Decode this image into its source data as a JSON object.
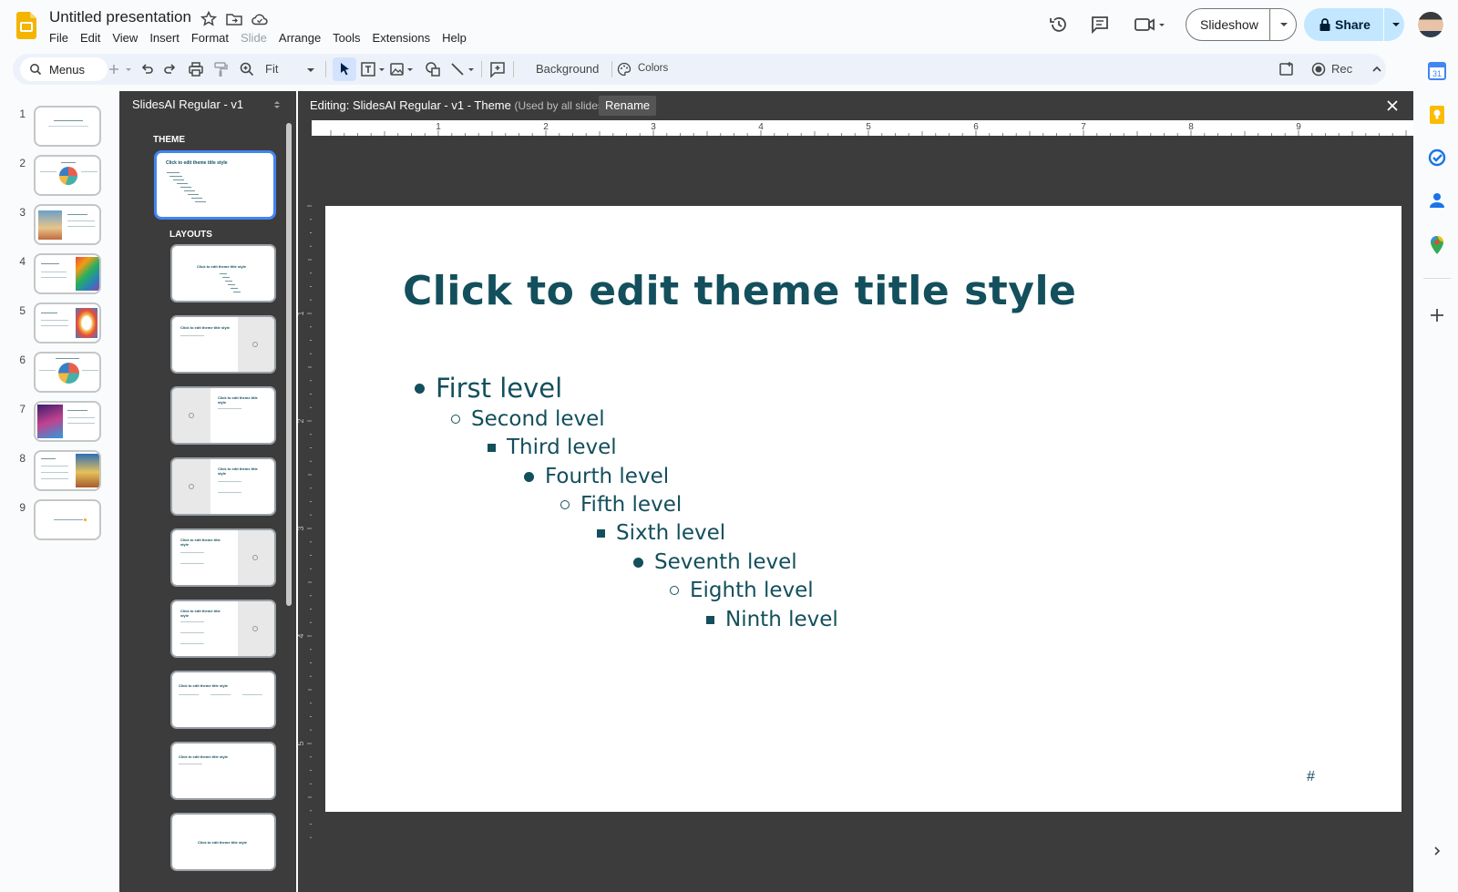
{
  "app": {
    "doc_title": "Untitled presentation",
    "menu": [
      "File",
      "Edit",
      "View",
      "Insert",
      "Format",
      "Slide",
      "Arrange",
      "Tools",
      "Extensions",
      "Help"
    ],
    "slideshow_label": "Slideshow",
    "share_label": "Share"
  },
  "toolbar": {
    "search_label": "Menus",
    "zoom_label": "Fit",
    "background_label": "Background",
    "colors_label": "Colors",
    "rec_label": "Rec"
  },
  "filmstrip": {
    "slide_numbers": [
      "1",
      "2",
      "3",
      "4",
      "5",
      "6",
      "7",
      "8",
      "9"
    ]
  },
  "theme_pane": {
    "theme_name": "SlidesAI Regular - v1",
    "theme_section": "THEME",
    "layouts_section": "LAYOUTS"
  },
  "editor": {
    "editing_label": "Editing: SlidesAI Regular - v1 - Theme",
    "used_by_label": "(Used by all slides)",
    "rename_label": "Rename",
    "ruler_numbers": [
      "1",
      "2",
      "3",
      "4",
      "5",
      "6",
      "7",
      "8",
      "9"
    ],
    "ruler_left_numbers": [
      "1",
      "2",
      "3",
      "4",
      "5"
    ]
  },
  "slide": {
    "title": "Click to edit theme title style",
    "levels": [
      "First level",
      "Second level",
      "Third level",
      "Fourth level",
      "Fifth level",
      "Sixth level",
      "Seventh level",
      "Eighth level",
      "Ninth level"
    ],
    "slide_number_placeholder": "#"
  },
  "colors": {
    "theme_dark": "#134f5c",
    "editor_bg": "#3c3c3c",
    "share_bg": "#c2e7ff",
    "accent_blue": "#4285f4"
  }
}
